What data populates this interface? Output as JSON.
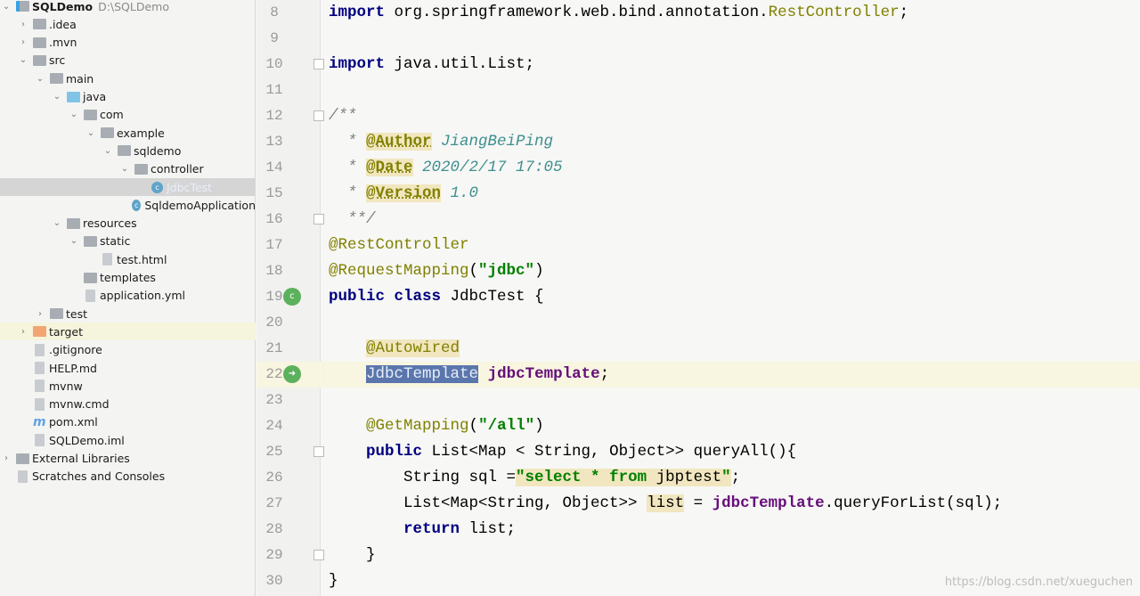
{
  "project_tree": [
    {
      "label": "SQLDemo",
      "path": "D:\\SQLDemo",
      "level": 0,
      "arrow": "down",
      "icon": "project-folder",
      "bold": true
    },
    {
      "label": ".idea",
      "level": 1,
      "arrow": "right",
      "icon": "folder"
    },
    {
      "label": ".mvn",
      "level": 1,
      "arrow": "right",
      "icon": "folder"
    },
    {
      "label": "src",
      "level": 1,
      "arrow": "down",
      "icon": "folder"
    },
    {
      "label": "main",
      "level": 2,
      "arrow": "down",
      "icon": "folder"
    },
    {
      "label": "java",
      "level": 3,
      "arrow": "down",
      "icon": "source-folder"
    },
    {
      "label": "com",
      "level": 4,
      "arrow": "down",
      "icon": "package"
    },
    {
      "label": "example",
      "level": 5,
      "arrow": "down",
      "icon": "package"
    },
    {
      "label": "sqldemo",
      "level": 6,
      "arrow": "down",
      "icon": "package"
    },
    {
      "label": "controller",
      "level": 7,
      "arrow": "down",
      "icon": "package"
    },
    {
      "label": "JdbcTest",
      "level": 8,
      "arrow": "",
      "icon": "class",
      "selected": true
    },
    {
      "label": "SqldemoApplication",
      "level": 7,
      "arrow": "",
      "icon": "spring-class"
    },
    {
      "label": "resources",
      "level": 3,
      "arrow": "down",
      "icon": "resources-folder"
    },
    {
      "label": "static",
      "level": 4,
      "arrow": "down",
      "icon": "folder"
    },
    {
      "label": "test.html",
      "level": 5,
      "arrow": "",
      "icon": "html-file"
    },
    {
      "label": "templates",
      "level": 4,
      "arrow": "",
      "icon": "folder"
    },
    {
      "label": "application.yml",
      "level": 4,
      "arrow": "",
      "icon": "yml-file"
    },
    {
      "label": "test",
      "level": 2,
      "arrow": "right",
      "icon": "folder"
    },
    {
      "label": "target",
      "level": 1,
      "arrow": "right",
      "icon": "excluded-folder",
      "highlight": true
    },
    {
      "label": ".gitignore",
      "level": 1,
      "arrow": "",
      "icon": "gitignore-file"
    },
    {
      "label": "HELP.md",
      "level": 1,
      "arrow": "",
      "icon": "markdown-file"
    },
    {
      "label": "mvnw",
      "level": 1,
      "arrow": "",
      "icon": "shell-file"
    },
    {
      "label": "mvnw.cmd",
      "level": 1,
      "arrow": "",
      "icon": "text-file"
    },
    {
      "label": "pom.xml",
      "level": 1,
      "arrow": "",
      "icon": "maven-file"
    },
    {
      "label": "SQLDemo.iml",
      "level": 1,
      "arrow": "",
      "icon": "iml-file"
    },
    {
      "label": "External Libraries",
      "level": 0,
      "arrow": "right",
      "icon": "libraries"
    },
    {
      "label": "Scratches and Consoles",
      "level": 0,
      "arrow": "",
      "icon": "scratches"
    }
  ],
  "editor": {
    "current_line": 22,
    "lines": [
      {
        "n": "8",
        "t": [
          [
            "kw",
            "import "
          ],
          [
            "",
            "org.springframework.web.bind.annotation."
          ],
          [
            "ann",
            "RestController"
          ],
          [
            "",
            ";"
          ]
        ]
      },
      {
        "n": "9",
        "t": []
      },
      {
        "n": "10",
        "fold": true,
        "t": [
          [
            "kw",
            "import "
          ],
          [
            "",
            "java.util.List;"
          ]
        ]
      },
      {
        "n": "11",
        "t": []
      },
      {
        "n": "12",
        "fold": true,
        "t": [
          [
            "cmt",
            "/**"
          ]
        ]
      },
      {
        "n": "13",
        "t": [
          [
            "cmt",
            "  * "
          ],
          [
            "tag",
            "@Author"
          ],
          [
            "tagv",
            " JiangBeiPing"
          ]
        ]
      },
      {
        "n": "14",
        "t": [
          [
            "cmt",
            "  * "
          ],
          [
            "tag",
            "@Date"
          ],
          [
            "tagv",
            " 2020/2/17 17:05"
          ]
        ]
      },
      {
        "n": "15",
        "t": [
          [
            "cmt",
            "  * "
          ],
          [
            "tag",
            "@Version"
          ],
          [
            "tagv",
            " 1.0"
          ]
        ]
      },
      {
        "n": "16",
        "fold": true,
        "t": [
          [
            "cmt",
            "  **/"
          ]
        ]
      },
      {
        "n": "17",
        "t": [
          [
            "ann",
            "@RestController"
          ]
        ]
      },
      {
        "n": "18",
        "t": [
          [
            "ann",
            "@RequestMapping"
          ],
          [
            "",
            "("
          ],
          [
            "str",
            "\"jdbc\""
          ],
          [
            "",
            ")"
          ]
        ]
      },
      {
        "n": "19",
        "gicon": "spring-bean-icon",
        "t": [
          [
            "kw",
            "public class "
          ],
          [
            "",
            "JdbcTest {"
          ]
        ]
      },
      {
        "n": "20",
        "t": []
      },
      {
        "n": "21",
        "t": [
          [
            "",
            "    "
          ],
          [
            "ann hl",
            "@Autowired"
          ]
        ]
      },
      {
        "n": "22",
        "gicon": "autowired-navigate-icon",
        "t": [
          [
            "",
            "    "
          ],
          [
            "sel",
            "JdbcTemplate"
          ],
          [
            "",
            " "
          ],
          [
            "fld",
            "jdbcTemplate"
          ],
          [
            "",
            ";"
          ]
        ]
      },
      {
        "n": "23",
        "t": []
      },
      {
        "n": "24",
        "t": [
          [
            "",
            "    "
          ],
          [
            "ann",
            "@GetMapping"
          ],
          [
            "",
            "("
          ],
          [
            "str",
            "\"/all\""
          ],
          [
            "",
            ")"
          ]
        ]
      },
      {
        "n": "25",
        "fold": true,
        "t": [
          [
            "",
            "    "
          ],
          [
            "kw",
            "public "
          ],
          [
            "",
            "List<Map < String, Object>> queryAll(){"
          ]
        ]
      },
      {
        "n": "26",
        "t": [
          [
            "",
            "        String sql ="
          ],
          [
            "str hl",
            "\"select * from "
          ],
          [
            "hl",
            "jbptest"
          ],
          [
            "str hl",
            "\""
          ],
          [
            "",
            ";"
          ]
        ]
      },
      {
        "n": "27",
        "t": [
          [
            "",
            "        List<Map<String, Object>> "
          ],
          [
            "hl",
            "list"
          ],
          [
            "",
            " = "
          ],
          [
            "fld",
            "jdbcTemplate"
          ],
          [
            "",
            ".queryForList(sql);"
          ]
        ]
      },
      {
        "n": "28",
        "t": [
          [
            "",
            "        "
          ],
          [
            "kw",
            "return "
          ],
          [
            "",
            "list;"
          ]
        ]
      },
      {
        "n": "29",
        "fold": true,
        "t": [
          [
            "",
            "    }"
          ]
        ]
      },
      {
        "n": "30",
        "t": [
          [
            "",
            "}"
          ]
        ]
      }
    ]
  },
  "watermark": "https://blog.csdn.net/xueguchen"
}
